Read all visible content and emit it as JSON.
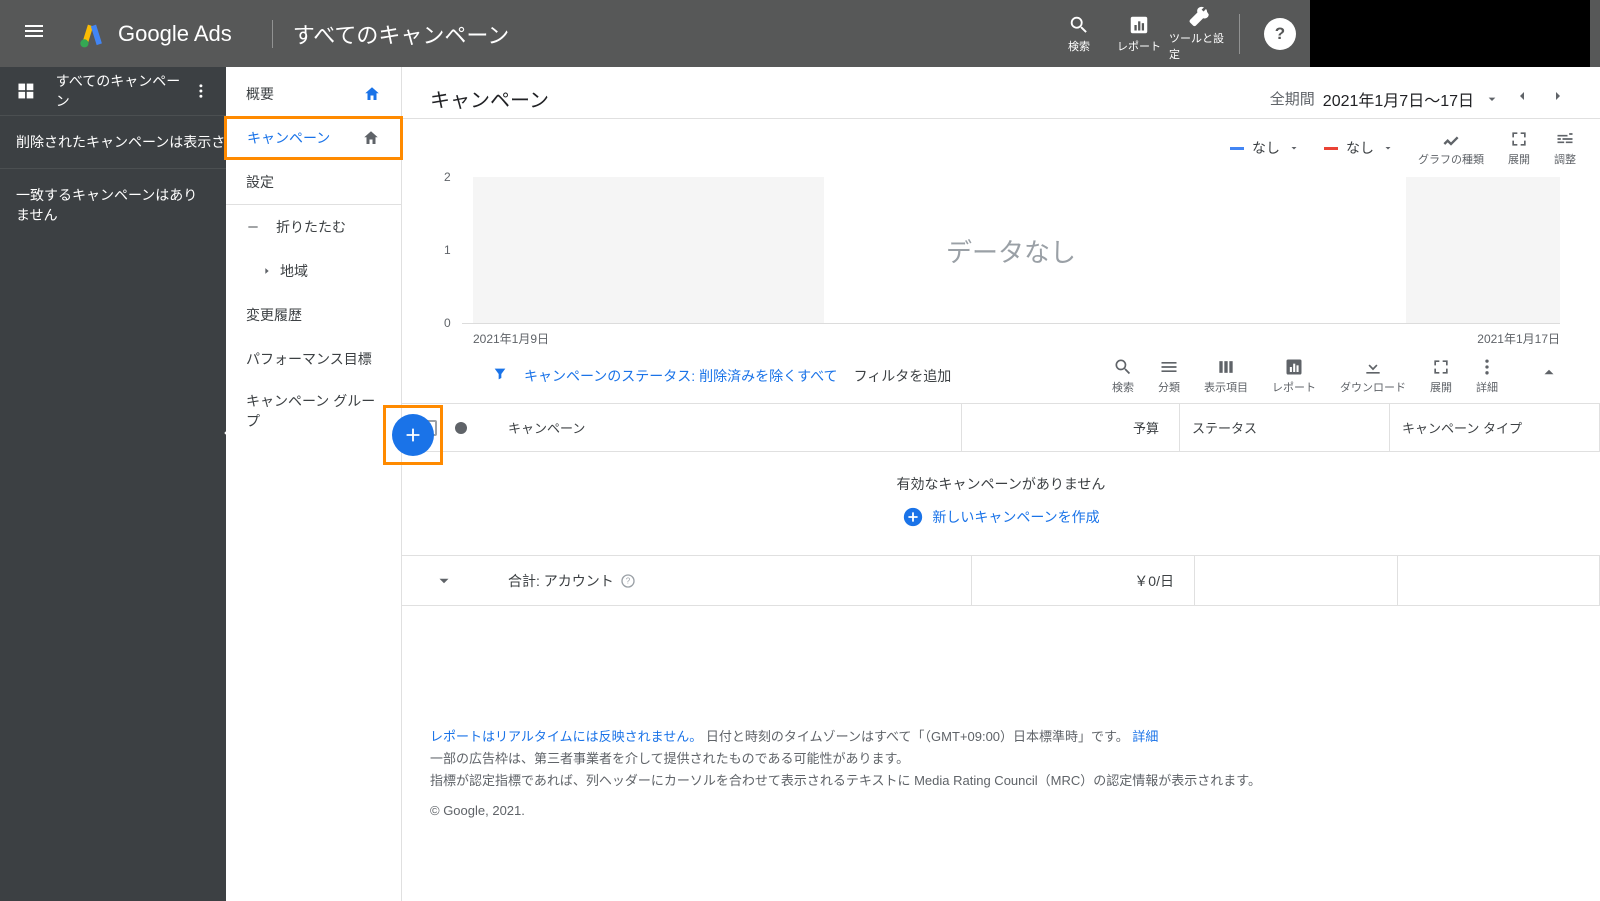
{
  "header": {
    "product": "Google Ads",
    "title": "すべてのキャンペーン",
    "search": "検索",
    "reports": "レポート",
    "tools": "ツールと設定"
  },
  "leftnav": {
    "all_campaigns": "すべてのキャンペーン",
    "deleted_note": "削除されたキャンペーンは表示されま",
    "no_match": "一致するキャンペーンはありません"
  },
  "secondnav": {
    "overview": "概要",
    "campaigns": "キャンペーン",
    "settings": "設定",
    "collapse": "折りたたむ",
    "regions": "地域",
    "change_history": "変更履歴",
    "performance_target": "パフォーマンス目標",
    "campaign_groups": "キャンペーン グループ"
  },
  "page": {
    "title": "キャンペーン",
    "date_prefix": "全期間",
    "date_range": "2021年1月7日～17日"
  },
  "chart_controls": {
    "series1": "なし",
    "series2": "なし",
    "graph_type": "グラフの種類",
    "expand": "展開",
    "adjust": "調整"
  },
  "chart_data": {
    "type": "line",
    "no_data_label": "データなし",
    "ylim": [
      0,
      2
    ],
    "yticks": [
      0,
      1,
      2
    ],
    "x_start": "2021年1月9日",
    "x_end": "2021年1月17日",
    "series": []
  },
  "filter": {
    "label": "キャンペーンのステータス:",
    "value": "削除済みを除くすべて",
    "add": "フィルタを追加"
  },
  "toolbar": {
    "search": "検索",
    "segment": "分類",
    "columns": "表示項目",
    "reports": "レポート",
    "download": "ダウンロード",
    "expand": "展開",
    "detail": "詳細"
  },
  "table": {
    "headers": {
      "campaign": "キャンペーン",
      "budget": "予算",
      "status": "ステータス",
      "type": "キャンペーン タイプ"
    },
    "empty_message": "有効なキャンペーンがありません",
    "create_new": "新しいキャンペーンを作成",
    "total_label": "合計: アカウント",
    "total_budget": "￥0/日"
  },
  "footer": {
    "line1_a": "レポートはリアルタイムには反映されません。",
    "line1_b": "日付と時刻のタイムゾーンはすべて「（GMT+09:00）日本標準時」です。",
    "detail_link": "詳細",
    "line2": "一部の広告枠は、第三者事業者を介して提供されたものである可能性があります。",
    "line3": "指標が認定指標であれば、列ヘッダーにカーソルを合わせて表示されるテキストに Media Rating Council（MRC）の認定情報が表示されます。",
    "copyright": "© Google, 2021."
  }
}
